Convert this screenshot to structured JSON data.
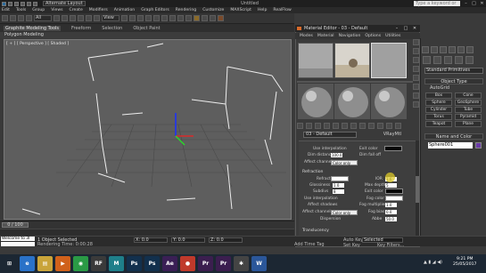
{
  "app": {
    "workspace": "Alternate Layout",
    "title": "Untitled",
    "search_placeholder": "Type a keyword or phrase"
  },
  "menu": [
    "Edit",
    "Tools",
    "Group",
    "Views",
    "Create",
    "Modifiers",
    "Animation",
    "Graph Editors",
    "Rendering",
    "Customize",
    "MAXScript",
    "Help",
    "RealFlow"
  ],
  "toolbar": {
    "filter": "All",
    "view": "View"
  },
  "ribbon": {
    "tabs": [
      "Graphite Modeling Tools",
      "Freeform",
      "Selection",
      "Object Paint"
    ],
    "panel": "Polygon Modeling"
  },
  "viewport": {
    "label": "[ + ] [ Perspective ] [ Shaded ]"
  },
  "timeline": {
    "position": "0 / 100"
  },
  "status": {
    "maxscript": "Welcome to 3I",
    "selected_count": "1 Object Selected",
    "render_time": "Rendering Time: 0:00:28",
    "x": "X: 0.0",
    "y": "Y: 0.0",
    "z": "Z: 0.0",
    "add_time_tag": "Add Time Tag",
    "auto_key": "Auto Key",
    "selected": "Selected",
    "set_key": "Set Key",
    "key_filters": "Key Filters..."
  },
  "taskbar": {
    "apps": [
      {
        "name": "start",
        "glyph": "⊞",
        "color": "#1c2733"
      },
      {
        "name": "ie",
        "glyph": "e",
        "color": "#2a72c8"
      },
      {
        "name": "explorer",
        "glyph": "▤",
        "color": "#c9a43a"
      },
      {
        "name": "media",
        "glyph": "▶",
        "color": "#d0611b"
      },
      {
        "name": "chrome",
        "glyph": "◉",
        "color": "#2a9a45"
      },
      {
        "name": "3dsmax",
        "glyph": "RF",
        "color": "#3a3a3a"
      },
      {
        "name": "maya",
        "glyph": "M",
        "color": "#1e7f8a"
      },
      {
        "name": "photoshop",
        "glyph": "Ps",
        "color": "#12304d"
      },
      {
        "name": "photoshop2",
        "glyph": "Ps",
        "color": "#12304d"
      },
      {
        "name": "aftereffects",
        "glyph": "Ae",
        "color": "#3a1f55"
      },
      {
        "name": "record",
        "glyph": "●",
        "color": "#c0392b"
      },
      {
        "name": "premiere",
        "glyph": "Pr",
        "color": "#3b1e4f"
      },
      {
        "name": "premiere2",
        "glyph": "Pr",
        "color": "#3b1e4f"
      },
      {
        "name": "app",
        "glyph": "✱",
        "color": "#444"
      },
      {
        "name": "word",
        "glyph": "W",
        "color": "#2b579a"
      }
    ],
    "time": "9:21 PM",
    "date": "25/05/2017"
  },
  "command_panel": {
    "dropdown": "Standard Primitives",
    "object_type": "Object Type",
    "autogrid": "AutoGrid",
    "buttons": [
      "Box",
      "Cone",
      "Sphere",
      "GeoSphere",
      "Cylinder",
      "Tube",
      "Torus",
      "Pyramid",
      "Teapot",
      "Plane"
    ],
    "name_color": "Name and Color",
    "name": "Sphere001",
    "color": "#6a3aa8"
  },
  "material_editor": {
    "title": "Material Editor - 03 - Default",
    "menu": [
      "Modes",
      "Material",
      "Navigation",
      "Options",
      "Utilities"
    ],
    "material_name": "03 - Default",
    "material_type": "VRayMtl",
    "params": {
      "use_interpolation": "Use interpolation",
      "dim_distance": "Dim distance",
      "dim_distance_val": "100.0",
      "exit_color": "Exit color",
      "dim_falloff": "Dim fall off",
      "affect_channels": "Affect channels",
      "channels_value": "Color only",
      "refraction": "Refraction",
      "refract": "Refract",
      "ior": "IOR",
      "ior_val": "1.6",
      "glossiness": "Glossiness",
      "glossiness_val": "1.0",
      "max_depth": "Max depth",
      "max_depth_val": "5",
      "subdivs": "Subdivs",
      "subdivs_val": "8",
      "exit_color2": "Exit color",
      "use_interpolation2": "Use interpolation",
      "fog_color": "Fog color",
      "affect_shadows": "Affect shadows",
      "fog_multiplier": "Fog multiplier",
      "fog_multiplier_val": "1.0",
      "affect_channels2": "Affect channels",
      "channels_value2": "Color only",
      "fog_bias": "Fog bias",
      "fog_bias_val": "0.0",
      "dispersion": "Dispersion",
      "abbe": "Abbe",
      "abbe_val": "50.0",
      "translucency": "Translucency",
      "type": "Type",
      "type_val": "None"
    }
  }
}
